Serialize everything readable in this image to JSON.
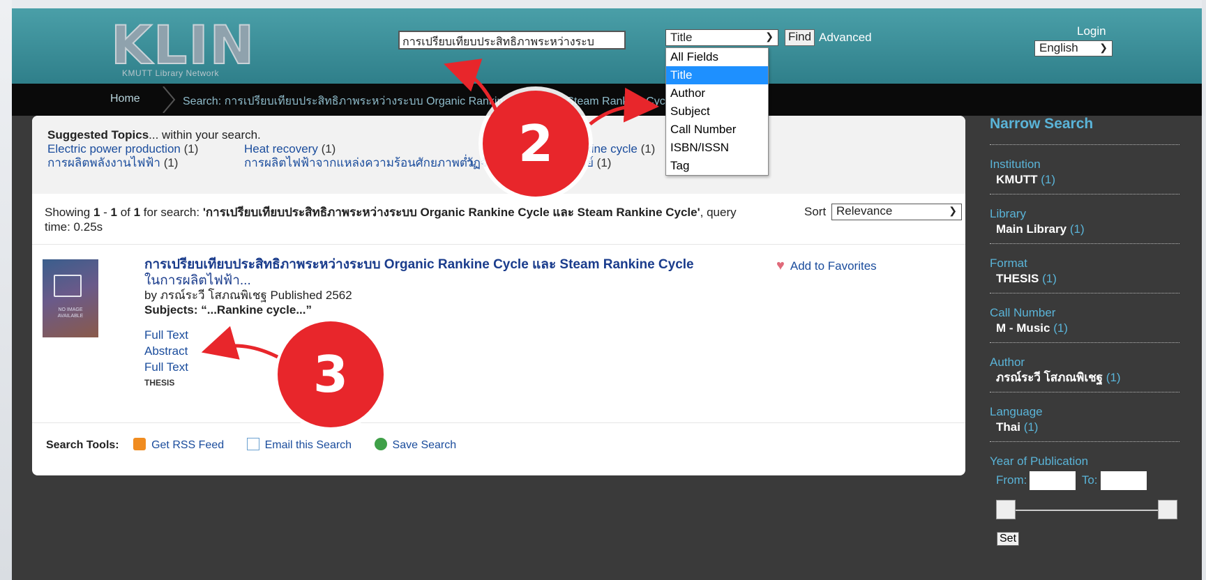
{
  "header": {
    "logo_text": "KLIN",
    "logo_subtitle": "KMUTT Library Network",
    "search_value": "การเปรียบเทียบประสิทธิภาพระหว่างระบ",
    "search_type_selected": "Title",
    "find_label": "Find",
    "advanced_label": "Advanced",
    "login_label": "Login",
    "language_selected": "English"
  },
  "search_type_options": [
    "All Fields",
    "Title",
    "Author",
    "Subject",
    "Call Number",
    "ISBN/ISSN",
    "Tag"
  ],
  "breadcrumb": {
    "home": "Home",
    "search": "Search: การเปรียบเทียบประสิทธิภาพระหว่างระบบ Organic Rankine Cycle และ Steam Rankine Cycle"
  },
  "topics": {
    "heading": "Suggested Topics",
    "heading_suffix": "... within your search.",
    "row1": [
      {
        "label": "Electric power production",
        "count": "(1)"
      },
      {
        "label": "Heat recovery",
        "count": "(1)"
      },
      {
        "label": "Rankine cycle",
        "count": "(1)"
      }
    ],
    "row2": [
      {
        "label": "การผลิตพลังงานไฟฟ้า",
        "count": "(1)"
      },
      {
        "label": "การผลิตไฟฟ้าจากแหล่งความร้อนศักยภาพต่ำ",
        "count": ""
      },
      {
        "label": "วัฏจักรแรงคินสารอินทรีย์",
        "count": "(1)"
      }
    ]
  },
  "results": {
    "showing_prefix": "Showing ",
    "range_start": "1",
    "range_sep": " - ",
    "range_end": "1",
    "of_text": " of ",
    "total": "1",
    "for_search": " for search: ",
    "query": "'การเปรียบเทียบประสิทธิภาพระหว่างระบบ Organic Rankine Cycle และ Steam Rankine Cycle'",
    "query_time": ", query time: 0.25s",
    "sort_label": "Sort",
    "sort_selected": "Relevance"
  },
  "record": {
    "thumb_text": "NO IMAGE AVAILABLE",
    "title": "การเปรียบเทียบประสิทธิภาพระหว่างระบบ Organic Rankine Cycle และ Steam Rankine Cycle",
    "title_tail": " ในการผลิตไฟฟ้า...",
    "by_prefix": "by ",
    "author": "ภรณ์ระวี โสภณพิเชฐ",
    "published": " Published 2562",
    "subjects_label": "Subjects: ",
    "subjects_value": "“...Rankine cycle...”",
    "links": [
      "Full Text",
      "Abstract",
      "Full Text"
    ],
    "format": "THESIS",
    "favorite_label": "Add to Favorites"
  },
  "tools": {
    "label": "Search Tools:",
    "rss": "Get RSS Feed",
    "email": "Email this Search",
    "save": "Save Search"
  },
  "sidebar": {
    "heading": "Narrow Search",
    "facets": [
      {
        "title": "Institution",
        "value": "KMUTT",
        "count": "(1)"
      },
      {
        "title": "Library",
        "value": "Main Library",
        "count": "(1)"
      },
      {
        "title": "Format",
        "value": "THESIS",
        "count": "(1)"
      },
      {
        "title": "Call Number",
        "value": "M - Music",
        "count": "(1)"
      },
      {
        "title": "Author",
        "value": "ภรณ์ระวี โสภณพิเชฐ",
        "count": "(1)"
      },
      {
        "title": "Language",
        "value": "Thai",
        "count": "(1)"
      }
    ],
    "year_title": "Year of Publication",
    "from_label": "From:",
    "to_label": "To:",
    "set_label": "Set"
  },
  "annotations": {
    "badge_2": "2",
    "badge_3": "3",
    "color": "#e8262b"
  }
}
